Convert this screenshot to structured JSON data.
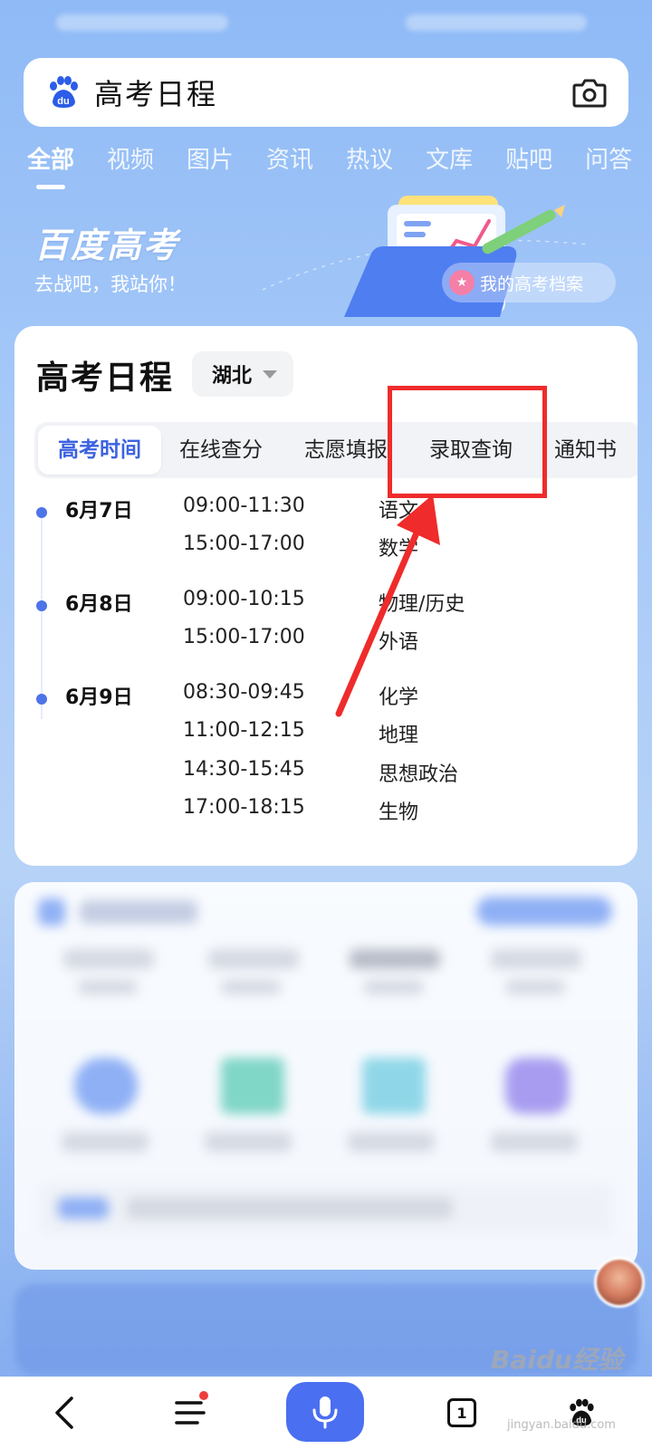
{
  "search": {
    "query": "高考日程"
  },
  "categories": [
    {
      "label": "全部",
      "active": true
    },
    {
      "label": "视频"
    },
    {
      "label": "图片"
    },
    {
      "label": "资讯"
    },
    {
      "label": "热议"
    },
    {
      "label": "文库"
    },
    {
      "label": "贴吧"
    },
    {
      "label": "问答"
    }
  ],
  "banner": {
    "title": "百度高考",
    "subtitle": "去战吧，我站你！",
    "archive_button": "我的高考档案"
  },
  "schedule_card": {
    "title": "高考日程",
    "region": "湖北",
    "tabs": [
      "高考时间",
      "在线查分",
      "志愿填报",
      "录取查询",
      "通知书"
    ],
    "active_tab": "高考时间",
    "days": [
      {
        "date": "6月7日",
        "sessions": [
          {
            "time": "09:00-11:30",
            "subject": "语文"
          },
          {
            "time": "15:00-17:00",
            "subject": "数学"
          }
        ]
      },
      {
        "date": "6月8日",
        "sessions": [
          {
            "time": "09:00-10:15",
            "subject": "物理/历史"
          },
          {
            "time": "15:00-17:00",
            "subject": "外语"
          }
        ]
      },
      {
        "date": "6月9日",
        "sessions": [
          {
            "time": "08:30-09:45",
            "subject": "化学"
          },
          {
            "time": "11:00-12:15",
            "subject": "地理"
          },
          {
            "time": "14:30-15:45",
            "subject": "思想政治"
          },
          {
            "time": "17:00-18:15",
            "subject": "生物"
          }
        ]
      }
    ]
  },
  "annotation": {
    "highlighted_tab": "录取查询",
    "color": "#ef2b2b"
  },
  "bottom_nav": {
    "tab_count": "1"
  },
  "watermark": {
    "text": "Baidu经验",
    "url": "jingyan.baidu.com"
  },
  "colors": {
    "accent": "#4a6ff0",
    "active_tab": "#3b62e0",
    "dot": "#4d74e8"
  }
}
